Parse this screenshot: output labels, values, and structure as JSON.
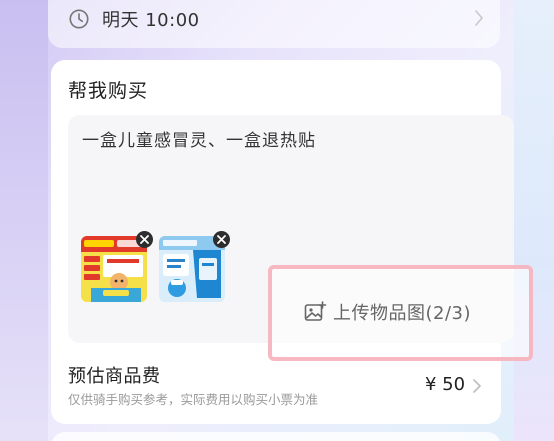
{
  "schedule": {
    "time_label": "明天 10:00",
    "clock_icon": "clock-icon",
    "chevron_icon": "chevron-right-icon"
  },
  "purchase": {
    "title": "帮我购买",
    "description": "一盒儿童感冒灵、一盒退热贴",
    "images": [
      {
        "name": "children-cold-medicine-box",
        "close_icon": "close-icon"
      },
      {
        "name": "fever-cooling-patch-box",
        "close_icon": "close-icon"
      }
    ],
    "upload_label": "上传物品图(2/3)",
    "upload_icon": "image-upload-icon"
  },
  "fee": {
    "title": "预估商品费",
    "note": "仅供骑手购买参考，实际费用以购买小票为准",
    "amount": "¥ 50",
    "chevron_icon": "chevron-right-icon"
  },
  "colors": {
    "highlight_frame": "#f6acb6",
    "card_background": "#ffffff",
    "text_area_background": "#f6f6f8"
  }
}
